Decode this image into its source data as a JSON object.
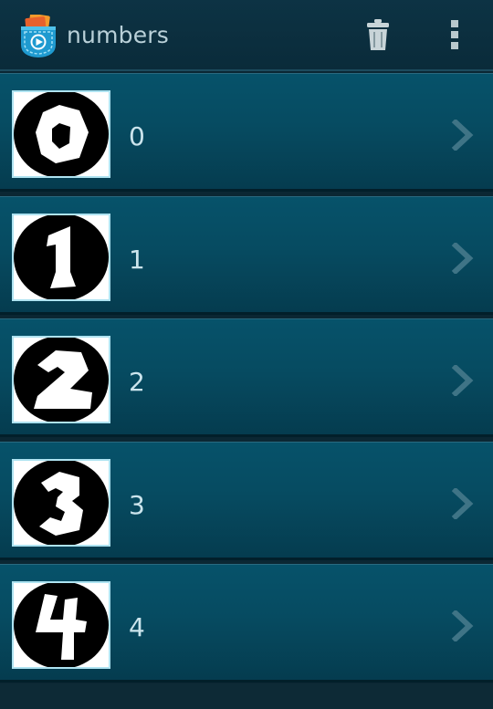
{
  "action_bar": {
    "title": "numbers",
    "icons": {
      "app": "pocket-play-icon",
      "delete": "trash-icon",
      "overflow": "overflow-menu-icon"
    }
  },
  "list": {
    "items": [
      {
        "label": "0",
        "thumbnail_glyph": "0"
      },
      {
        "label": "1",
        "thumbnail_glyph": "1"
      },
      {
        "label": "2",
        "thumbnail_glyph": "2"
      },
      {
        "label": "3",
        "thumbnail_glyph": "3"
      },
      {
        "label": "4",
        "thumbnail_glyph": "4"
      }
    ]
  },
  "colors": {
    "action_bar_bg": "#0b2d3c",
    "row_bg": "#064b61",
    "thumbnail_border": "#aee3f1",
    "label_text": "#cbe4ec",
    "title_text": "#b9d0d8"
  }
}
